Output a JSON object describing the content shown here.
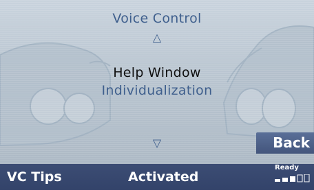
{
  "header": {
    "title": "Voice Control"
  },
  "navigation": {
    "up_icon": "triangle-up-icon",
    "down_icon": "triangle-down-icon",
    "up_glyph": "△",
    "down_glyph": "▽"
  },
  "menu": {
    "items": [
      {
        "label": "Help Window",
        "selected": true
      },
      {
        "label": "Individualization",
        "selected": false
      }
    ]
  },
  "back_button": {
    "label": "Back"
  },
  "bottom_bar": {
    "left_softkey": "VC Tips",
    "status": "Activated",
    "ready_label": "Ready",
    "signal_level": 0.6
  },
  "colors": {
    "text_accent": "#3f5f8d",
    "bar": "#3c4d74",
    "button": "#4c5f88",
    "background": "#c0cbd6"
  }
}
